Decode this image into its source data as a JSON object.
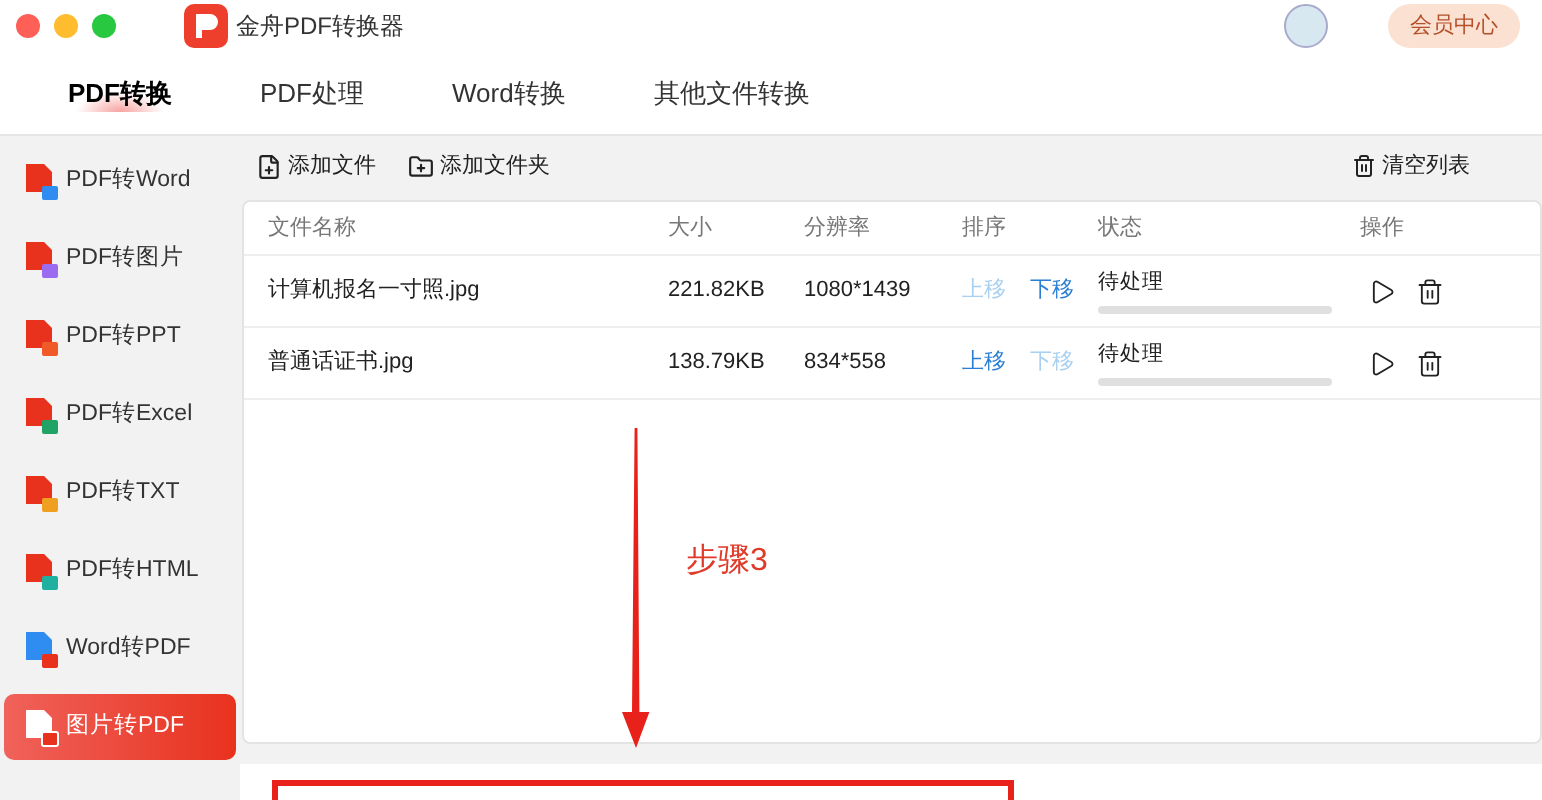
{
  "window": {
    "title": "金舟PDF转换器",
    "member_button": "会员中心"
  },
  "tabs": [
    {
      "label": "PDF转换",
      "selected": true
    },
    {
      "label": "PDF处理",
      "selected": false
    },
    {
      "label": "Word转换",
      "selected": false
    },
    {
      "label": "其他文件转换",
      "selected": false
    }
  ],
  "sidebar": {
    "items": [
      {
        "label": "PDF转Word",
        "kind": "word",
        "selected": false
      },
      {
        "label": "PDF转图片",
        "kind": "image",
        "selected": false
      },
      {
        "label": "PDF转PPT",
        "kind": "ppt",
        "selected": false
      },
      {
        "label": "PDF转Excel",
        "kind": "excel",
        "selected": false
      },
      {
        "label": "PDF转TXT",
        "kind": "txt",
        "selected": false
      },
      {
        "label": "PDF转HTML",
        "kind": "html",
        "selected": false
      },
      {
        "label": "Word转PDF",
        "kind": "toPdf",
        "selected": false
      },
      {
        "label": "图片转PDF",
        "kind": "imgToPdf",
        "selected": true
      }
    ]
  },
  "toolbar": {
    "add_file": "添加文件",
    "add_folder": "添加文件夹",
    "clear": "清空列表"
  },
  "table": {
    "columns": [
      "文件名称",
      "大小",
      "分辨率",
      "排序",
      "状态",
      "操作"
    ],
    "rows": [
      {
        "name": "计算机报名一寸照.jpg",
        "size": "221.82KB",
        "resolution": "1080*1439",
        "up": "上移",
        "up_disabled": true,
        "down": "下移",
        "down_disabled": false,
        "status": "待处理",
        "level": 0
      },
      {
        "name": "普通话证书.jpg",
        "size": "138.79KB",
        "resolution": "834*558",
        "up": "上移",
        "up_disabled": false,
        "down": "下移",
        "down_disabled": true,
        "status": "待处理",
        "level": 0
      }
    ]
  },
  "annotation": {
    "label": "步骤3"
  }
}
